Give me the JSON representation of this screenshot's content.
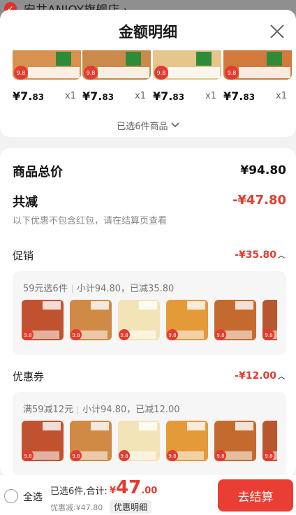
{
  "store": {
    "name": "安井ANJOY旗舰店 ›"
  },
  "sheet": {
    "title": "金额明细"
  },
  "products": [
    {
      "price_main": "¥7.",
      "price_cents": "83",
      "qty": "x1",
      "color": "#d8924f"
    },
    {
      "price_main": "¥7.",
      "price_cents": "83",
      "qty": "x1",
      "color": "#c98a4a"
    },
    {
      "price_main": "¥7.",
      "price_cents": "83",
      "qty": "x1",
      "color": "#e6c68a"
    },
    {
      "price_main": "¥7.",
      "price_cents": "83",
      "qty": "x1",
      "color": "#d27a3c"
    }
  ],
  "badge_text": "9.8",
  "selected_count": "已选6件商品",
  "summary": {
    "total_label": "商品总价",
    "total_value": "¥94.80",
    "discount_label": "共减",
    "discount_value": "-¥47.80",
    "discount_note": "以下优惠不包含红包，请在结算页查看"
  },
  "promo": {
    "label": "促销",
    "value": "-¥35.80",
    "info_left": "59元选6件",
    "info_right": "小计94.80，已减35.80"
  },
  "coupon": {
    "label": "优惠券",
    "value": "-¥12.00",
    "info_left": "满59减12元",
    "info_right": "小计94.80，已减12.00"
  },
  "mini_colors": [
    "#c0522f",
    "#d08a45",
    "#f3e4b8",
    "#e59a3a",
    "#c46a2e",
    "#b8562f"
  ],
  "bottom": {
    "select_all": "全选",
    "summary_text": "已选6件,合计:",
    "amount_yen": "¥",
    "amount_big": "47",
    "amount_small": ".00",
    "discount_text": "优惠减:¥47.80",
    "detail_tag": "优惠明细",
    "checkout": "去结算"
  },
  "colors": {
    "accent": "#e33b2f",
    "checkout_bg": "#ea3d33"
  }
}
